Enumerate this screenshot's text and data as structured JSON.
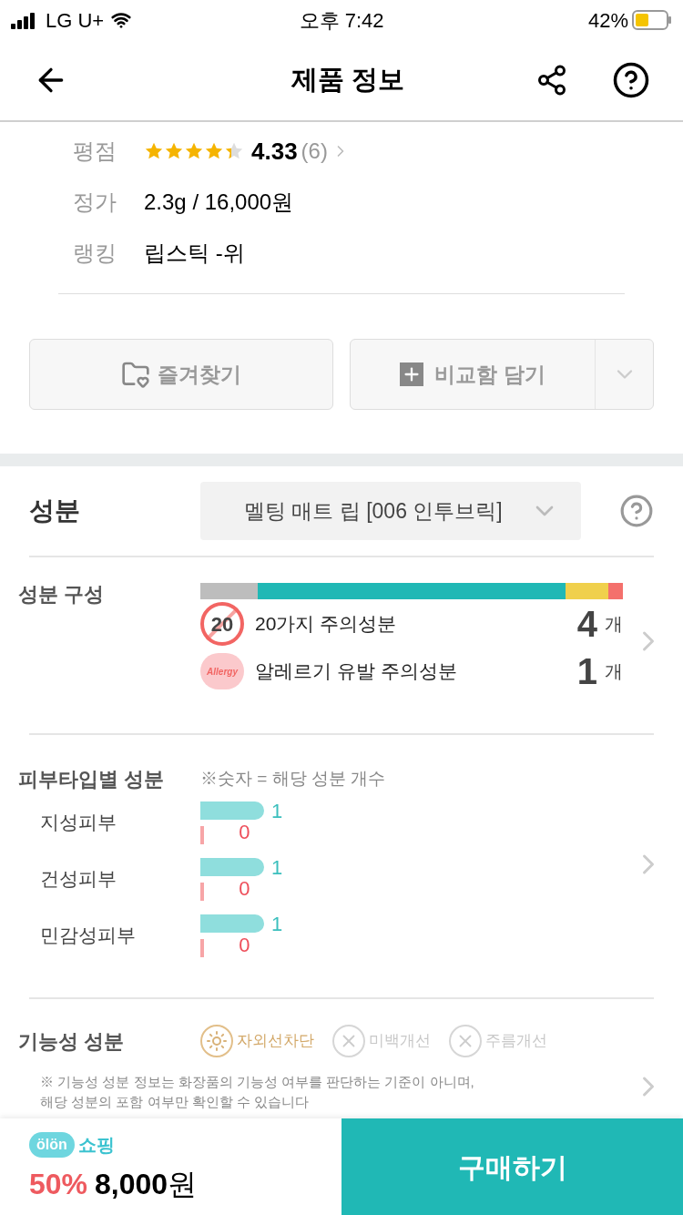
{
  "status_bar": {
    "carrier": "LG U+",
    "time": "오후 7:42",
    "battery": "42%"
  },
  "header": {
    "title": "제품 정보"
  },
  "info": [
    {
      "kind": "rating",
      "label": "평점",
      "stars": 4.33,
      "score": "4.33",
      "count": "(6)"
    },
    {
      "kind": "text",
      "label": "정가",
      "value": "2.3g / 16,000원"
    },
    {
      "kind": "text",
      "label": "랭킹",
      "value": "립스틱 -위"
    }
  ],
  "actions": {
    "favorite": "즐겨찾기",
    "compare": "비교함 담기"
  },
  "ingredients": {
    "title": "성분",
    "product_select": "멜팅 매트 립 [006 인투브릭]",
    "composition": {
      "title": "성분 구성",
      "segments": [
        {
          "color": "#bdbdbd"
        },
        {
          "color": "#20b8b5"
        },
        {
          "color": "#f0d04c"
        },
        {
          "color": "#f4706c"
        }
      ],
      "warnings": [
        {
          "kind": "twenty",
          "icon_text": "20",
          "label": "20가지 주의성분",
          "count": "4",
          "unit": "개"
        },
        {
          "kind": "allergy",
          "icon_text": "Allergy",
          "label": "알레르기 유발 주의성분",
          "count": "1",
          "unit": "개"
        }
      ]
    },
    "skin": {
      "title": "피부타입별 성분",
      "note": "※숫자 = 해당 성분 개수",
      "rows": [
        {
          "label": "지성피부",
          "good": {
            "level": 1,
            "value": "1"
          },
          "bad": {
            "value": "0"
          }
        },
        {
          "label": "건성피부",
          "good": {
            "level": 1,
            "value": "1"
          },
          "bad": {
            "value": "0"
          }
        },
        {
          "label": "민감성피부",
          "good": {
            "level": 1,
            "value": "1"
          },
          "bad": {
            "value": "0"
          }
        }
      ]
    },
    "functional": {
      "title": "기능성 성분",
      "items": [
        {
          "label": "자외선차단",
          "active": true
        },
        {
          "label": "미백개선",
          "active": false
        },
        {
          "label": "주름개선",
          "active": false
        }
      ],
      "notes": [
        "※ 기능성 성분 정보는 화장품의 기능성 여부를 판단하는 기준이 아니며,",
        "해당 성분의 포함 여부만 확인할 수 있습니다"
      ]
    }
  },
  "bottom_bar": {
    "logo": "ölön",
    "shop": "쇼핑",
    "discount": "50%",
    "price": "8,000",
    "currency": "원",
    "buy": "구매하기"
  }
}
